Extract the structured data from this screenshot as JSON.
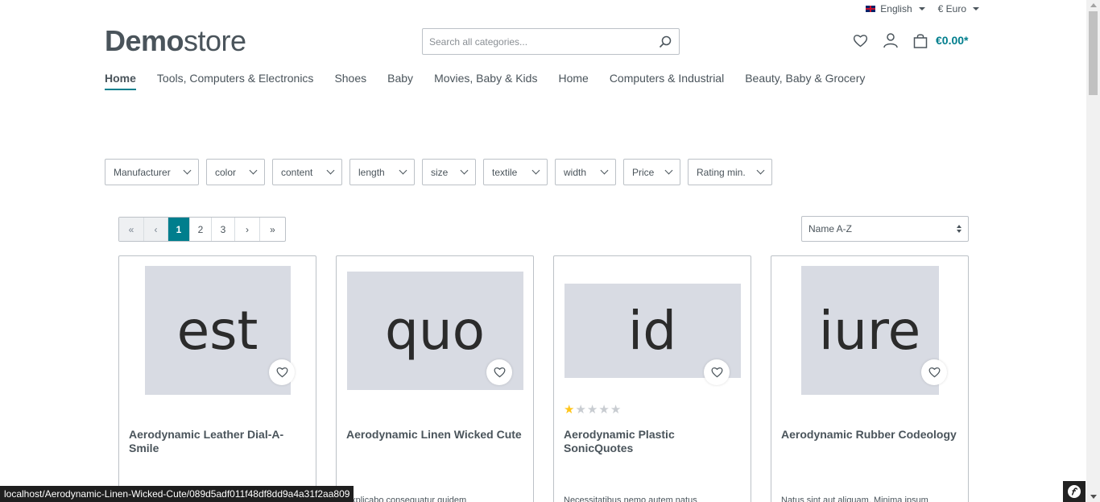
{
  "topbar": {
    "language": "English",
    "currency": "€ Euro"
  },
  "logo": {
    "bold": "Demo",
    "light": "store"
  },
  "search": {
    "placeholder": "Search all categories..."
  },
  "cart": {
    "total": "€0.00*"
  },
  "nav": [
    {
      "label": "Home",
      "active": true
    },
    {
      "label": "Tools, Computers & Electronics"
    },
    {
      "label": "Shoes"
    },
    {
      "label": "Baby"
    },
    {
      "label": "Movies, Baby & Kids"
    },
    {
      "label": "Home"
    },
    {
      "label": "Computers & Industrial"
    },
    {
      "label": "Beauty, Baby & Grocery"
    }
  ],
  "filters": [
    "Manufacturer",
    "color",
    "content",
    "length",
    "size",
    "textile",
    "width",
    "Price",
    "Rating min."
  ],
  "pagination": {
    "first": "«",
    "prev": "‹",
    "pages": [
      "1",
      "2",
      "3"
    ],
    "current": "1",
    "next": "›",
    "last": "»"
  },
  "sort": {
    "selected": "Name A-Z"
  },
  "products": [
    {
      "image_text": "est",
      "name": "Aerodynamic Leather Dial-A-Smile",
      "rating": 0,
      "desc": ""
    },
    {
      "image_text": "quo",
      "name": "Aerodynamic Linen Wicked Cute",
      "rating": 0,
      "desc": "explicabo consequatur quidem"
    },
    {
      "image_text": "id",
      "name": "Aerodynamic Plastic SonicQuotes",
      "rating": 1,
      "desc": "Necessitatibus nemo autem natus"
    },
    {
      "image_text": "iure",
      "name": "Aerodynamic Rubber Codeology",
      "rating": 0,
      "desc": "Natus sint aut aliquam. Minima ipsum"
    }
  ],
  "status_url": "localhost/Aerodynamic-Linen-Wicked-Cute/089d5adf011f48df8dd9a4a31f2aa809",
  "colors": {
    "accent": "#007e8d",
    "text": "#4a545b",
    "placeholder_bg": "#d8dbe3",
    "star": "#ffc51a"
  }
}
